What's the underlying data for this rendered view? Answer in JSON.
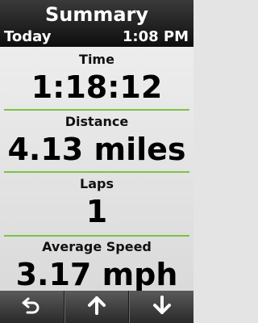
{
  "header": {
    "title": "Summary",
    "date_label": "Today",
    "time": "1:08 PM"
  },
  "stats": [
    {
      "label": "Time",
      "value": "1:18:12"
    },
    {
      "label": "Distance",
      "value": "4.13 miles"
    },
    {
      "label": "Laps",
      "value": "1"
    },
    {
      "label": "Average Speed",
      "value": "3.17 mph"
    }
  ],
  "toolbar": {
    "back_icon": "back-arrow-icon",
    "up_icon": "arrow-up-icon",
    "down_icon": "arrow-down-icon"
  },
  "colors": {
    "divider": "#7cc242",
    "header_bg": "#1a1a1a"
  }
}
